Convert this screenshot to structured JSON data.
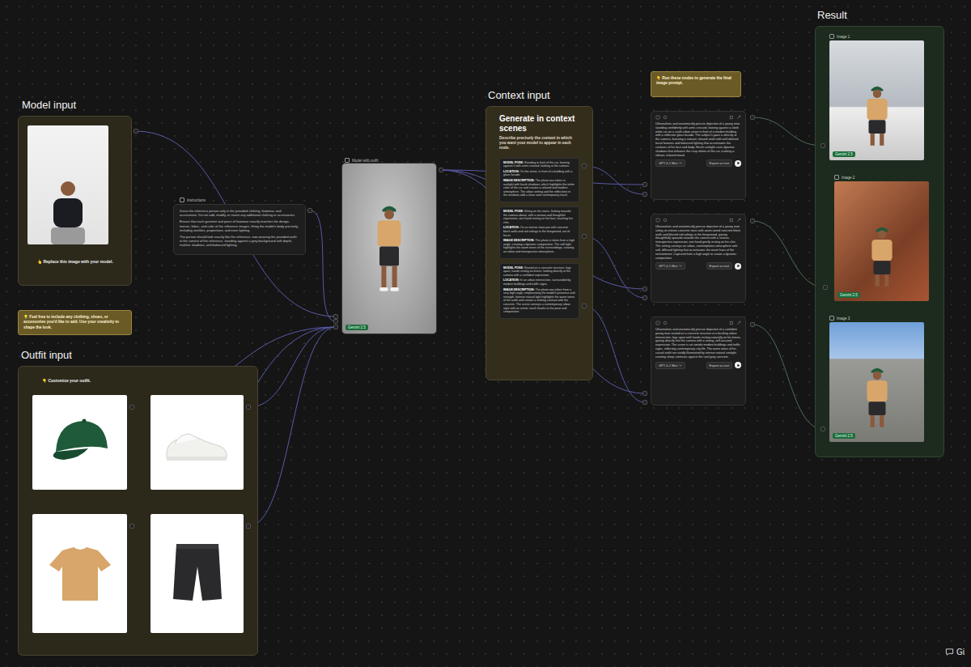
{
  "model_input": {
    "title": "Model input",
    "hint": "👆 Replace this image with your model."
  },
  "outfit_note": "💡 Feel free to include any clothing, shoes, or accessories you'd like to add. Use your creativity to shape the look.",
  "outfit_input": {
    "title": "Outfit input",
    "hint": "👇 Customize your outfit."
  },
  "instructions": {
    "title": "Instructions",
    "paragraphs": [
      "Dress the reference person only in the provided clothing, footwear, and accessories. Do not add, modify, or invent any additional clothing or accessories.",
      "Ensure that each garment and piece of footwear exactly matches the design, texture, fabric, and color of the reference images, fitting the model's body precisely, including wrinkles, proportions, and even lighting.",
      "The person should look exactly like the reference, now wearing the provided outfit in the context of the reference, standing against a grey background with depth, realistic shadows, and balanced lighting."
    ]
  },
  "model_node": {
    "title": "Model with outfit",
    "badge": "Gemini 2.5"
  },
  "context_input": {
    "title": "Context input",
    "heading": "Generate in context scenes",
    "subtitle": "Describe precisely the context in which you want your model to appear in each node.",
    "scenes": [
      {
        "fields": [
          {
            "label": "MODEL POSE:",
            "text": "Standing in front of the car, leaning against it with arms crossed, looking at the camera."
          },
          {
            "label": "LOCATION:",
            "text": "On the street, in front of a building with a glass facade."
          },
          {
            "label": "IMAGE DESCRIPTION:",
            "text": "The photo was taken in sunlight with harsh shadows, which highlights the white color of the car and creates a relaxed and modern atmosphere. The urban setting and the reflections in the windows add a clean and contemporary touch."
          }
        ]
      },
      {
        "fields": [
          {
            "label": "MODEL POSE:",
            "text": "Sitting on the stairs, looking towards the camera above, with a serious and thoughtful expression, one hand resting on his face, touching his chin."
          },
          {
            "label": "LOCATION:",
            "text": "On an interior staircase with concrete block walls and red railings in the foreground, out of focus."
          },
          {
            "label": "IMAGE DESCRIPTION:",
            "text": "The photo is taken from a high angle, creating a dynamic composition. The soft light highlights the warm tones of the surroundings, creating an urban and introspective atmosphere."
          }
        ]
      },
      {
        "fields": [
          {
            "label": "MODEL POSE:",
            "text": "Seated on a concrete structure, legs apart, hands resting on knees, looking directly at the camera with a confident expression."
          },
          {
            "label": "LOCATION:",
            "text": "In an urban intersection, surrounded by modern buildings and traffic signs."
          },
          {
            "label": "IMAGE DESCRIPTION:",
            "text": "The photo was taken from a very high angle, emphasizing the model's presence and strength. Intense natural light highlights the warm tones of the outfit and creates a striking contrast with the concrete. The scene conveys a contemporary urban style with an artistic touch thanks to the pose and composition."
          }
        ]
      }
    ]
  },
  "run_note": "👇 Run these nodes to generate the final image prompt.",
  "prompt_nodes": [
    {
      "text": "Ultrarealistic and anatomically precise depiction of a young man standing confidently with arms crossed, leaning against a sleek white car on a sunlit urban street in front of a modern building with a reflective glass facade. The subject's gaze is directly at the camera, featuring a natural, relaxed smile with well-defined facial features and balanced lighting that accentuates the contours of his face and body. Harsh sunlight casts dynamic shadows that enhance the crisp whites of the car, evoking a vibrant, relaxed mood.",
      "model": "GPT-4.1 Mini",
      "export": "Export as text"
    },
    {
      "text": "Ultrarealistic and anatomically precise depiction of a young man sitting on interior concrete stairs with warm-toned concrete block walls and blurred red railings in the foreground, gazing thoughtfully upwards towards the camera with a serious, introspective expression, one hand gently resting on his chin. The setting conveys an urban, contemplative atmosphere with soft, diffused lighting that accentuates the warm hues of the environment. Captured from a high angle to create a dynamic composition.",
      "model": "GPT-4.1 Mini",
      "export": "Export as text"
    },
    {
      "text": "Ultrarealistic and anatomically precise depiction of a confident young man seated on a concrete structure at a bustling urban intersection, legs apart with hands resting naturally on his knees, gazing directly into the camera with a strong, self-assured expression. The scene is set amidst modern buildings and traffic signs, reflecting contemporary city life. The warm tones of his casual outfit are vividly illuminated by intense natural sunlight, creating sharp contrasts against the cool grey concrete.",
      "model": "GPT-4.1 Mini",
      "export": "Export as text"
    }
  ],
  "result": {
    "title": "Result",
    "images": [
      {
        "label": "Image 1",
        "badge": "Gemini 2.5"
      },
      {
        "label": "Image 2",
        "badge": "Gemini 2.5"
      },
      {
        "label": "Image 3",
        "badge": "Gemini 2.5"
      }
    ]
  },
  "chat_button": "Gi"
}
